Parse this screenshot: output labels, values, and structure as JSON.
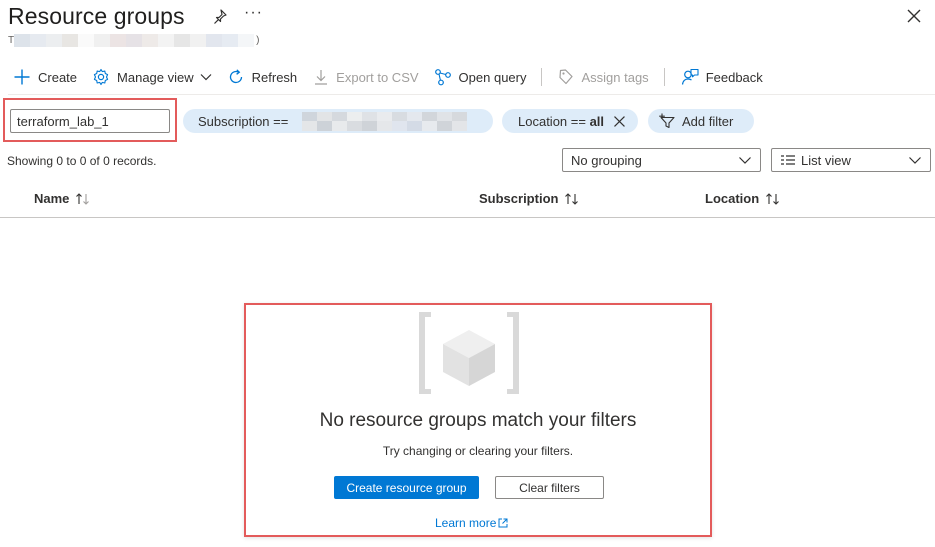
{
  "header": {
    "title": "Resource groups",
    "more_label": "···",
    "subtitle_prefix": "T",
    "subtitle_suffix": ")"
  },
  "toolbar": {
    "create": "Create",
    "manage_view": "Manage view",
    "refresh": "Refresh",
    "export_csv": "Export to CSV",
    "open_query": "Open query",
    "assign_tags": "Assign tags",
    "feedback": "Feedback"
  },
  "filters": {
    "search_value": "terraform_lab_1",
    "subscription_label": "Subscription ==",
    "location_label": "Location ==",
    "location_value": "all",
    "add_filter": "Add filter"
  },
  "records_text": "Showing 0 to 0 of 0 records.",
  "grouping": {
    "selected": "No grouping"
  },
  "view": {
    "selected": "List view"
  },
  "columns": [
    "Name",
    "Subscription",
    "Location"
  ],
  "empty_state": {
    "title": "No resource groups match your filters",
    "subtitle": "Try changing or clearing your filters.",
    "create_button": "Create resource group",
    "clear_button": "Clear filters",
    "learn_more": "Learn more"
  },
  "colors": {
    "accent": "#0078d4",
    "pill_bg": "#deecf9",
    "highlight_border": "#e35b5b"
  },
  "icons": {
    "pin": "pin-icon",
    "more": "more-icon",
    "close": "close-icon",
    "create": "plus-icon",
    "manage_view": "gear-icon",
    "refresh": "refresh-icon",
    "export": "download-icon",
    "open_query": "query-icon",
    "assign_tags": "tag-icon",
    "feedback": "feedback-icon",
    "location_clear": "close-icon",
    "add_filter": "filter-add-icon",
    "dropdown": "chevron-down-icon",
    "list_view": "list-icon",
    "sort": "sort-icon",
    "empty_state": "resource-group-icon",
    "external_link": "external-link-icon"
  }
}
